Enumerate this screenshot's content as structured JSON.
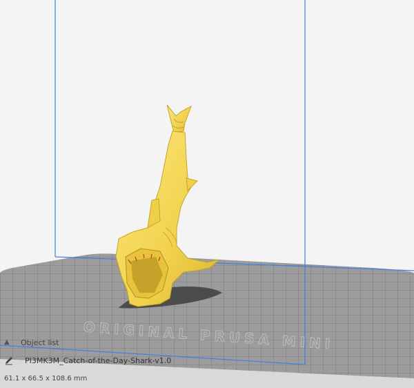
{
  "object_list": {
    "header_label": "Object list",
    "toggle_icon": "chevron-up-icon"
  },
  "object": {
    "edit_icon": "pencil-icon",
    "name": "PI3MK3M_Catch-of-the-Day-Shark-v1.0",
    "dimensions": "61.1 x 66.5 x 108.6 mm"
  },
  "viewport": {
    "model_color": "#f5dc5a",
    "build_volume_color": "#3f7fe0",
    "plate_color": "#8a8a8a",
    "plate_text": "ORIGINAL PRUSA MINI"
  }
}
